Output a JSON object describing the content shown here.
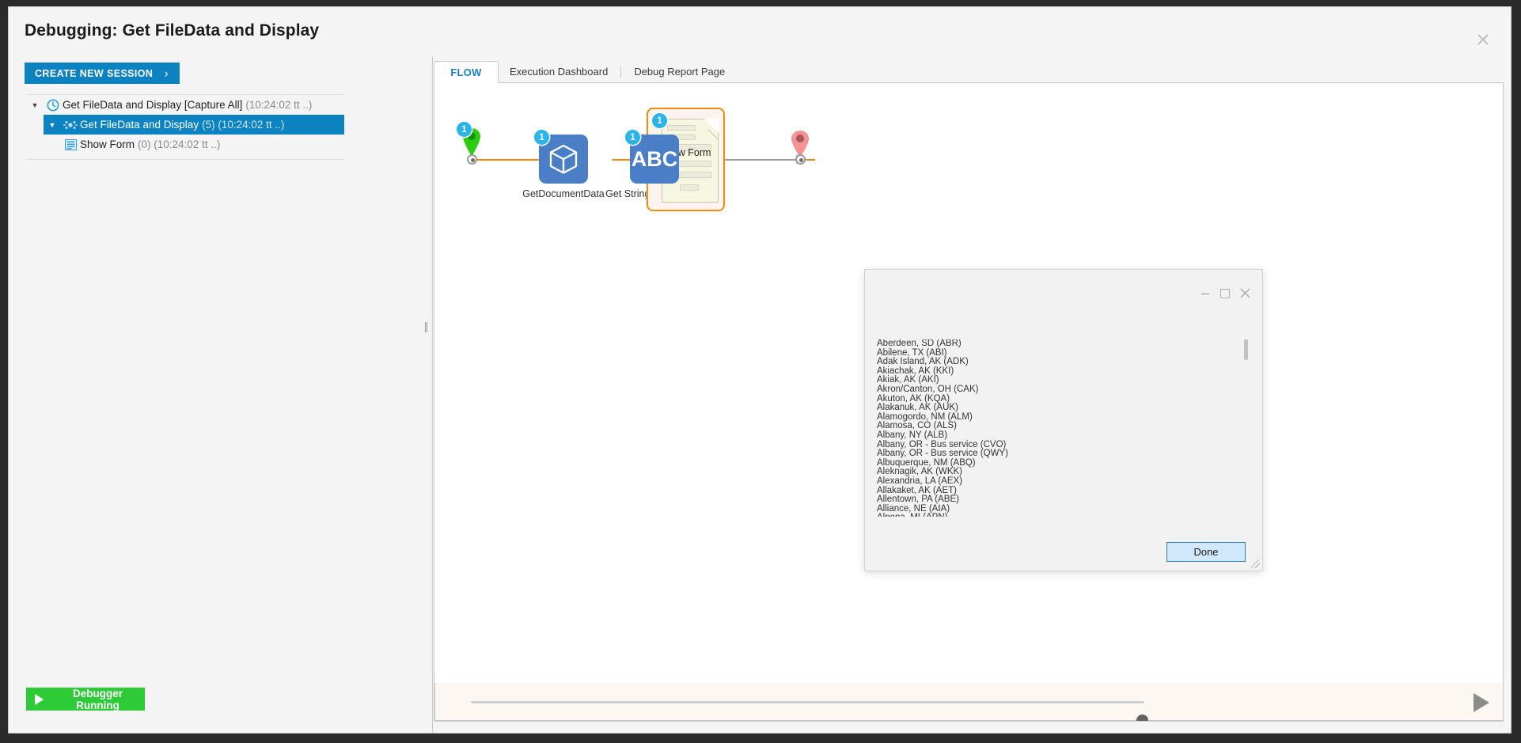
{
  "window": {
    "title": "Debugging: Get FileData and Display",
    "close_icon": "close-icon"
  },
  "sidebar": {
    "create_session_label": "CREATE NEW SESSION",
    "create_session_chevron": "›",
    "tree": [
      {
        "twisty": "▼",
        "icon": "clock-icon",
        "label": "Get FileData and Display [Capture All]",
        "meta": "(10:24:02 tt ..)",
        "selected": false,
        "indent": 1
      },
      {
        "twisty": "▼",
        "icon": "flow-icon",
        "label": "Get FileData and Display",
        "meta": "(5) (10:24:02 tt ..)",
        "selected": true,
        "indent": 2
      },
      {
        "twisty": "",
        "icon": "form-icon",
        "label": "Show Form",
        "meta": "(0) (10:24:02 tt ..)",
        "selected": false,
        "indent": 3
      }
    ],
    "debugger_status_label": "Debugger Running",
    "debugger_status_color": "#2dcc36"
  },
  "tabs": [
    {
      "label": "FLOW",
      "active": true
    },
    {
      "label": "Execution Dashboard",
      "active": false
    },
    {
      "label": "Debug Report Page",
      "active": false
    }
  ],
  "flow": {
    "accent_connector_color": "#f0870b",
    "badge_color": "#2ab4e8",
    "start_node": {
      "icon": "start-pin-icon",
      "badge": "1",
      "color": "#2ecc0f"
    },
    "end_node": {
      "icon": "end-pin-icon",
      "color": "#f08a8f"
    },
    "steps": [
      {
        "name": "GetDocumentData",
        "badge": "1",
        "icon": "cube-icon",
        "label": "GetDocumentData"
      },
      {
        "name": "get-string-from-bytes",
        "badge": "1",
        "icon": "abc-icon",
        "glyph": "ABC",
        "label": "Get String From Bytes"
      },
      {
        "name": "show-form",
        "badge": "1",
        "icon": "form-document-icon",
        "label": "Show Form",
        "highlighted": true
      }
    ]
  },
  "form_dialog": {
    "minimize_icon": "minimize-icon",
    "maximize_icon": "maximize-icon",
    "close_icon": "close-icon",
    "done_label": "Done",
    "cities": [
      "Aberdeen, SD (ABR)",
      "Abilene, TX (ABI)",
      "Adak Island, AK (ADK)",
      "Akiachak, AK (KKI)",
      "Akiak, AK (AKI)",
      "Akron/Canton, OH (CAK)",
      "Akuton, AK (KQA)",
      "Alakanuk, AK (AUK)",
      "Alamogordo, NM (ALM)",
      "Alamosa, CO (ALS)",
      "Albany, NY (ALB)",
      "Albany, OR - Bus service (CVO)",
      "Albany, OR - Bus service (QWY)",
      "Albuquerque, NM (ABQ)",
      "Aleknagik, AK (WKK)",
      "Alexandria, LA (AEX)",
      "Allakaket, AK (AET)",
      "Allentown, PA (ABE)",
      "Alliance, NE (AIA)",
      "Alpena, MI (APN)"
    ]
  },
  "bottom_bar": {
    "slider_value": 99,
    "play_icon": "play-icon"
  }
}
